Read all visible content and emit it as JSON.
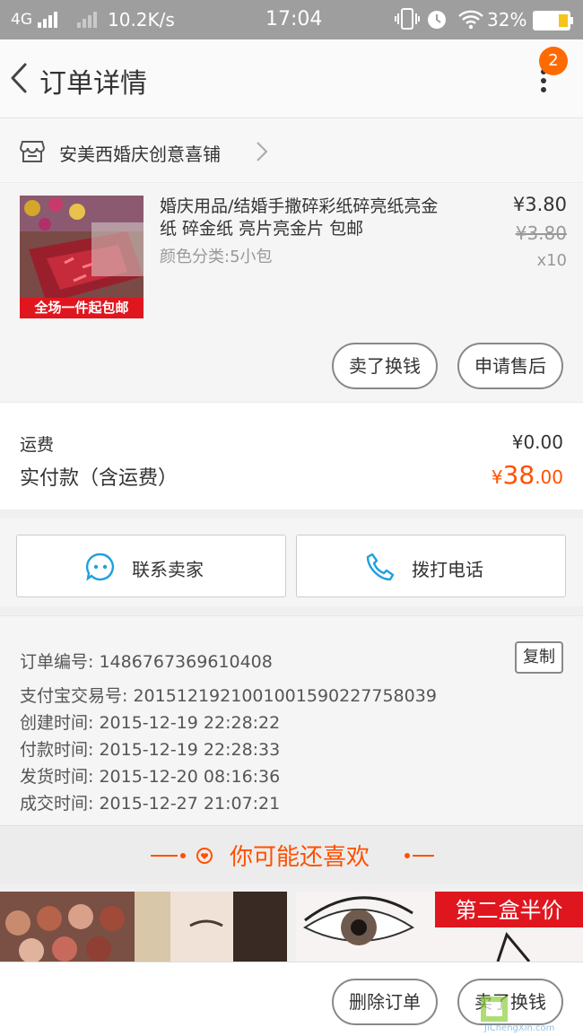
{
  "status_bar": {
    "network": "4G",
    "speed": "10.2K/s",
    "time": "17:04",
    "battery": "32%"
  },
  "header": {
    "title": "订单详情",
    "badge_count": "2"
  },
  "shop": {
    "name": "安美西婚庆创意喜铺"
  },
  "product": {
    "title": "婚庆用品/结婚手撒碎彩纸碎亮纸亮金纸 碎金纸 亮片亮金片 包邮",
    "sku": "颜色分类:5小包",
    "image_caption": "全场一件起包邮",
    "price": "¥3.80",
    "original_price": "¥3.80",
    "quantity": "x10",
    "actions": [
      "卖了换钱",
      "申请售后"
    ]
  },
  "totals": {
    "shipping_label": "运费",
    "shipping_value": "¥0.00",
    "paid_label": "实付款（含运费）",
    "paid_currency": "¥",
    "paid_int": "38",
    "paid_dec": ".00"
  },
  "contact": {
    "seller_label": "联系卖家",
    "phone_label": "拨打电话"
  },
  "order_info": {
    "order_no": "订单编号: 1486767369610408",
    "copy_label": "复制",
    "alipay_no": "支付宝交易号: 2015121921001001590227758039",
    "created": "创建时间: 2015-12-19 22:28:22",
    "paid": "付款时间: 2015-12-19 22:28:33",
    "shipped": "发货时间: 2015-12-20 08:16:36",
    "completed": "成交时间: 2015-12-27 21:07:21"
  },
  "recommend": {
    "title": "你可能还喜欢",
    "promo_text": "第二盒半价"
  },
  "bottom_bar": {
    "delete_label": "删除订单",
    "resell_label": "卖了换钱"
  },
  "watermark": {
    "text": "JiChengXin.com"
  },
  "colors": {
    "accent": "#ff5000",
    "badge": "#ff6a00",
    "icon_blue": "#1fa0e0",
    "status_bar": "#9e9e9e"
  }
}
